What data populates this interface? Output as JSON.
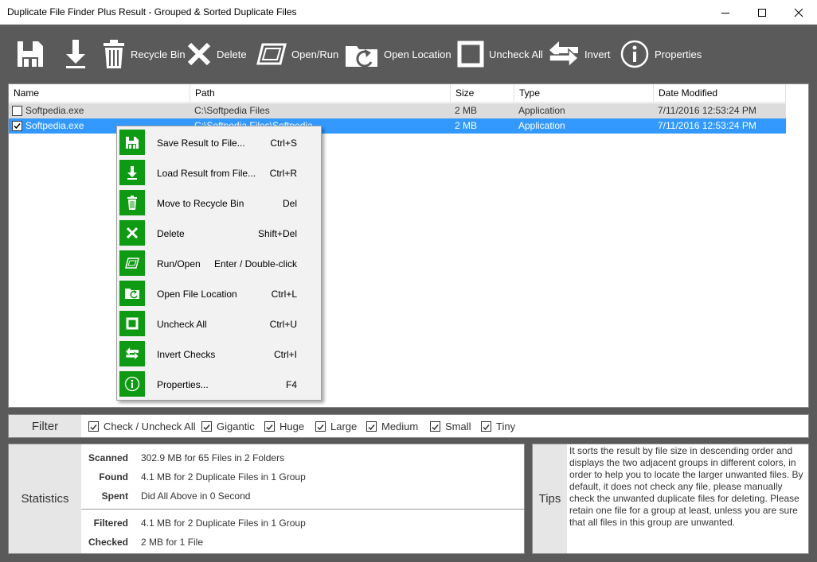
{
  "window": {
    "title": "Duplicate File Finder Plus Result - Grouped & Sorted Duplicate Files"
  },
  "toolbar": {
    "save": {
      "icon": "save-icon"
    },
    "load": {
      "icon": "download-icon"
    },
    "recycle": {
      "icon": "recycle-bin-icon",
      "label": "Recycle Bin"
    },
    "delete": {
      "icon": "x-icon",
      "label": "Delete"
    },
    "openrun": {
      "icon": "open-run-icon",
      "label": "Open/Run"
    },
    "openloc": {
      "icon": "folder-arrow-icon",
      "label": "Open Location"
    },
    "uncheck": {
      "icon": "square-icon",
      "label": "Uncheck All"
    },
    "invert": {
      "icon": "invert-arrows-icon",
      "label": "Invert"
    },
    "properties": {
      "icon": "info-icon",
      "label": "Properties"
    }
  },
  "table": {
    "columns": [
      "Name",
      "Path",
      "Size",
      "Type",
      "Date Modified"
    ],
    "rows": [
      {
        "checked": false,
        "name": "Softpedia.exe",
        "path": "C:\\Softpedia Files",
        "size": "2 MB",
        "type": "Application",
        "date": "7/11/2016 12:53:24 PM"
      },
      {
        "checked": true,
        "name": "Softpedia.exe",
        "path": "C:\\Softpedia Files\\Softpedia",
        "size": "2 MB",
        "type": "Application",
        "date": "7/11/2016 12:53:24 PM"
      }
    ]
  },
  "context_menu": {
    "items": [
      {
        "label": "Save Result to File...",
        "shortcut": "Ctrl+S",
        "icon": "save-icon"
      },
      {
        "label": "Load Result from File...",
        "shortcut": "Ctrl+R",
        "icon": "download-icon"
      },
      {
        "label": "Move to Recycle Bin",
        "shortcut": "Del",
        "icon": "recycle-bin-icon"
      },
      {
        "label": "Delete",
        "shortcut": "Shift+Del",
        "icon": "x-icon"
      },
      {
        "label": "Run/Open",
        "shortcut": "Enter / Double-click",
        "icon": "open-run-icon"
      },
      {
        "label": "Open File Location",
        "shortcut": "Ctrl+L",
        "icon": "folder-arrow-icon"
      },
      {
        "label": "Uncheck All",
        "shortcut": "Ctrl+U",
        "icon": "square-icon"
      },
      {
        "label": "Invert Checks",
        "shortcut": "Ctrl+I",
        "icon": "invert-arrows-icon"
      },
      {
        "label": "Properties...",
        "shortcut": "F4",
        "icon": "info-icon"
      }
    ]
  },
  "filter": {
    "label": "Filter",
    "items": [
      {
        "label": "Check / Uncheck All",
        "checked": true
      },
      {
        "label": "Gigantic",
        "checked": true
      },
      {
        "label": "Huge",
        "checked": true
      },
      {
        "label": "Large",
        "checked": true
      },
      {
        "label": "Medium",
        "checked": true
      },
      {
        "label": "Small",
        "checked": true
      },
      {
        "label": "Tiny",
        "checked": true
      }
    ]
  },
  "statistics": {
    "label": "Statistics",
    "scanned_key": "Scanned",
    "scanned_val": "302.9 MB for 65 Files in 2 Folders",
    "found_key": "Found",
    "found_val": "4.1 MB for 2 Duplicate Files in 1 Group",
    "spent_key": "Spent",
    "spent_val": "Did All Above in 0 Second",
    "filtered_key": "Filtered",
    "filtered_val": "4.1 MB for 2 Duplicate Files in 1 Group",
    "checked_key": "Checked",
    "checked_val": "2 MB for 1 File"
  },
  "tips": {
    "label": "Tips",
    "text": "It sorts the result by file size in descending order and displays the two adjacent groups in different colors, in order to help you to locate the larger unwanted files. By default, it does not check any file, please manually check the unwanted duplicate files for deleting. Please retain one file for a group at least, unless you are sure that all files in this group are unwanted."
  },
  "colors": {
    "toolbar_bg": "#5a5a5a",
    "accent_green": "#0e9a13",
    "selection": "#3399ff",
    "group_gray": "#dcdcdc"
  }
}
